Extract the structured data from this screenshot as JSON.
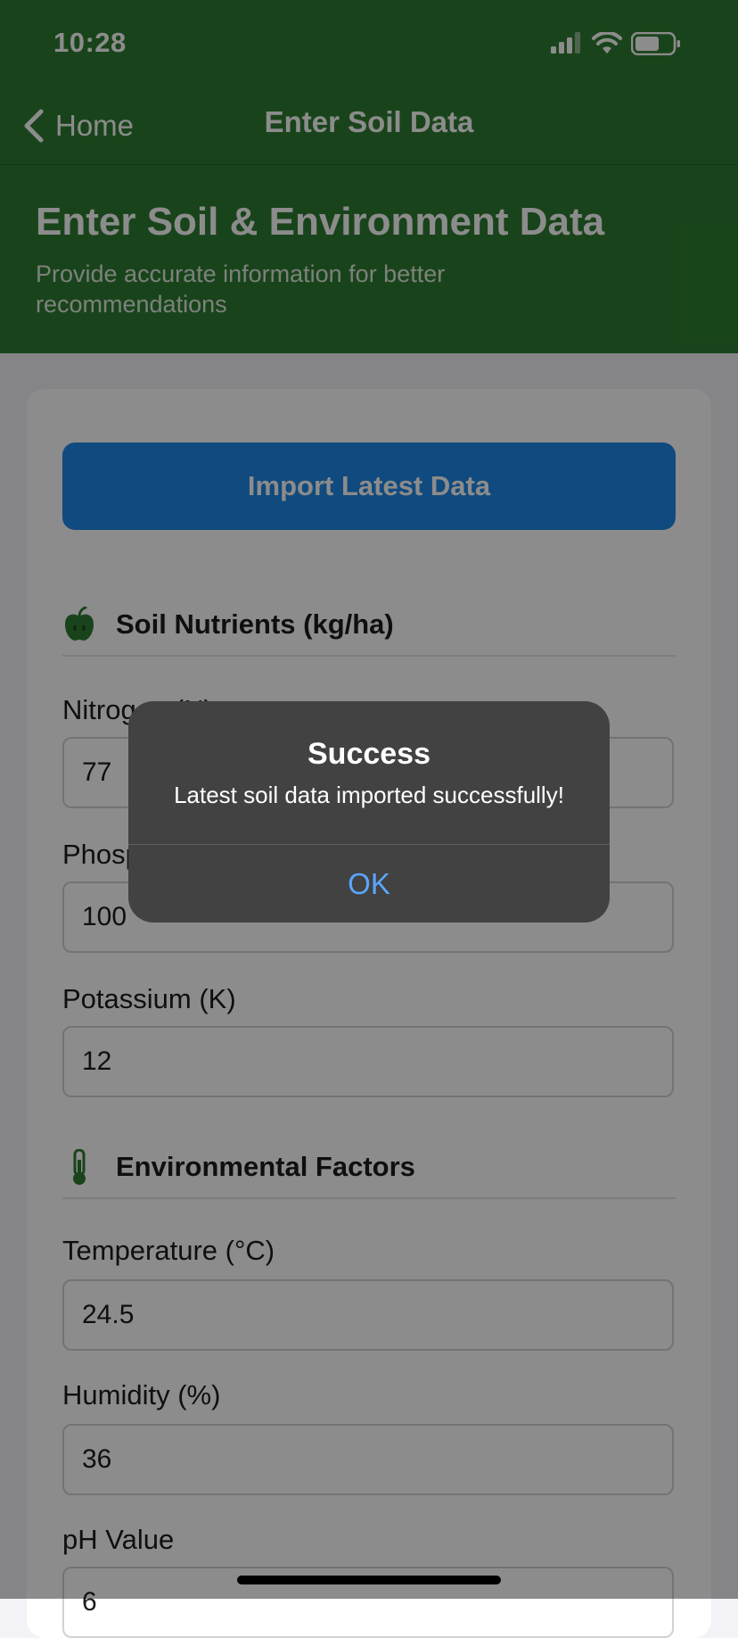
{
  "status_bar": {
    "time": "10:28",
    "icons": [
      "cellular-signal-icon",
      "wifi-icon",
      "battery-icon"
    ]
  },
  "nav": {
    "back_label": "Home",
    "title": "Enter Soil Data"
  },
  "page": {
    "heading": "Enter Soil & Environment Data",
    "subheading": "Provide accurate information for better recommendations"
  },
  "actions": {
    "import_label": "Import Latest Data"
  },
  "sections": {
    "nutrients": {
      "title": "Soil Nutrients (kg/ha)",
      "icon": "apple-icon"
    },
    "environment": {
      "title": "Environmental Factors",
      "icon": "thermometer-icon"
    }
  },
  "fields": {
    "nitrogen": {
      "label": "Nitrogen (N)",
      "value": "77"
    },
    "phosphorus": {
      "label": "Phosphorus (P)",
      "value": "100"
    },
    "potassium": {
      "label": "Potassium (K)",
      "value": "12"
    },
    "temperature": {
      "label": "Temperature (°C)",
      "value": "24.5"
    },
    "humidity": {
      "label": "Humidity (%)",
      "value": "36"
    },
    "ph": {
      "label": "pH Value",
      "value": "6"
    }
  },
  "alert": {
    "title": "Success",
    "message": "Latest soil data imported successfully!",
    "ok_label": "OK"
  },
  "colors": {
    "header_green": "#2e7d32",
    "button_blue": "#1e88e5",
    "icon_green": "#2e7d32",
    "alert_bg": "#424242",
    "alert_ok": "#5aa6ff"
  }
}
